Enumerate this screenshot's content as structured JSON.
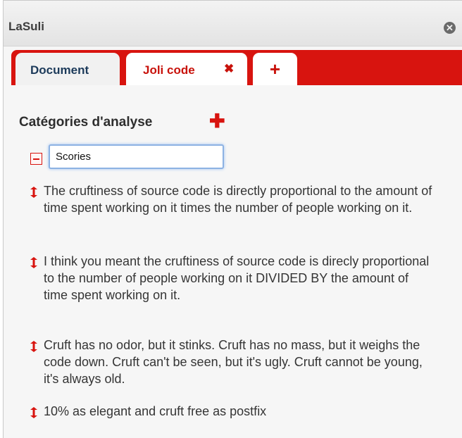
{
  "window": {
    "title": "LaSuli",
    "close_icon": "close-circle-icon"
  },
  "tabs": [
    {
      "label": "Document",
      "active": false
    },
    {
      "label": "Joli code",
      "active": true,
      "close_glyph": "✖"
    },
    {
      "label": "+",
      "kind": "add-tab"
    }
  ],
  "section": {
    "title": "Catégories d'analyse",
    "add_glyph": "✚"
  },
  "category": {
    "name_value": "Scories",
    "collapse_icon": "collapse-minus-icon"
  },
  "items": [
    {
      "text": "The cruftiness of source code is directly proportional to the amount of time spent working on it times the number of people working on it."
    },
    {
      "text": "I think you meant the cruftiness of source code is direcly proportional to the number of people working on it DIVIDED BY the amount of time spent working on it."
    },
    {
      "text": "Cruft has no odor, but it stinks. Cruft has no mass, but it weighs the code down. Cruft can't be seen, but it's ugly. Cruft cannot be young, it's always old."
    },
    {
      "text": "10% as elegant and cruft free as postfix"
    }
  ],
  "colors": {
    "accent": "#d8140f",
    "tab_active_text": "#c8120b",
    "tab_inactive_text": "#1c3a5a",
    "input_focus": "#8db2e3"
  }
}
